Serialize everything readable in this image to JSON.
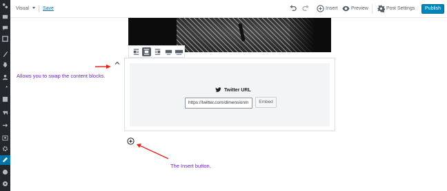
{
  "toolbar": {
    "mode": "Visual",
    "save_label": "Save",
    "insert_label": "Insert",
    "preview_label": "Preview",
    "post_settings_label": "Post Settings",
    "publish_label": "Publish"
  },
  "embed": {
    "label": "Twitter URL",
    "url_value": "https://twitter.com/dimensionm",
    "button_label": "Embed"
  },
  "annotations": {
    "swap": "Allows you to swap the content blocks.",
    "insert": "The Insert button."
  },
  "colors": {
    "accent": "#0085ba",
    "annotation_text": "#6d1fc7",
    "arrow": "#e3231b",
    "admin_bar": "#23282d"
  },
  "icons": {
    "undo": "undo-icon",
    "redo": "redo-icon",
    "insert": "plus-circle-icon",
    "preview": "eye-icon",
    "settings": "gear-icon",
    "twitter": "twitter-bird-icon",
    "mover": "chevron-up-icon"
  }
}
